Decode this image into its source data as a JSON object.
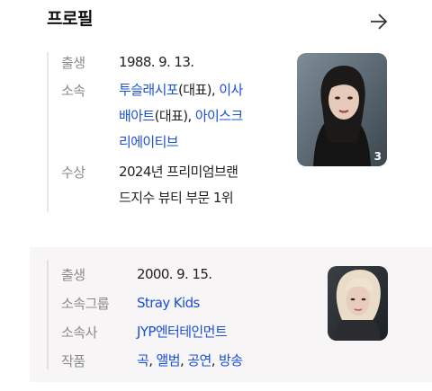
{
  "header": {
    "title": "프로필",
    "arrow_icon": "arrow-right-icon"
  },
  "profile1": {
    "birth_label": "출생",
    "birth_value": "1988. 9. 13.",
    "agency_label": "소속",
    "agency_line1_link1": "투슬래시포",
    "agency_line1_mid": "(대표), ",
    "agency_line1_link2": "이사",
    "agency_line2_link2_cont": "배아트",
    "agency_line2_mid": "(대표), ",
    "agency_line2_link3": "아이스크",
    "agency_line3_link3_cont": "리에이티브",
    "award_label": "수상",
    "award_line1": "2024년 프리미엄브랜",
    "award_line2": "드지수 뷰티 부문 1위",
    "photo_count": "3"
  },
  "profile2": {
    "birth_label": "출생",
    "birth_value": "2000. 9. 15.",
    "group_label": "소속그룹",
    "group_value": "Stray Kids",
    "company_label": "소속사",
    "company_value": "JYP엔터테인먼트",
    "works_label": "작품",
    "works_link1": "곡",
    "works_link2": "앨범",
    "works_link3": "공연",
    "works_link4": "방송",
    "works_sep": ", "
  },
  "colors": {
    "link": "#1a4fd6",
    "label": "#8a8a8a",
    "card2_bg": "#f7f5f6"
  }
}
